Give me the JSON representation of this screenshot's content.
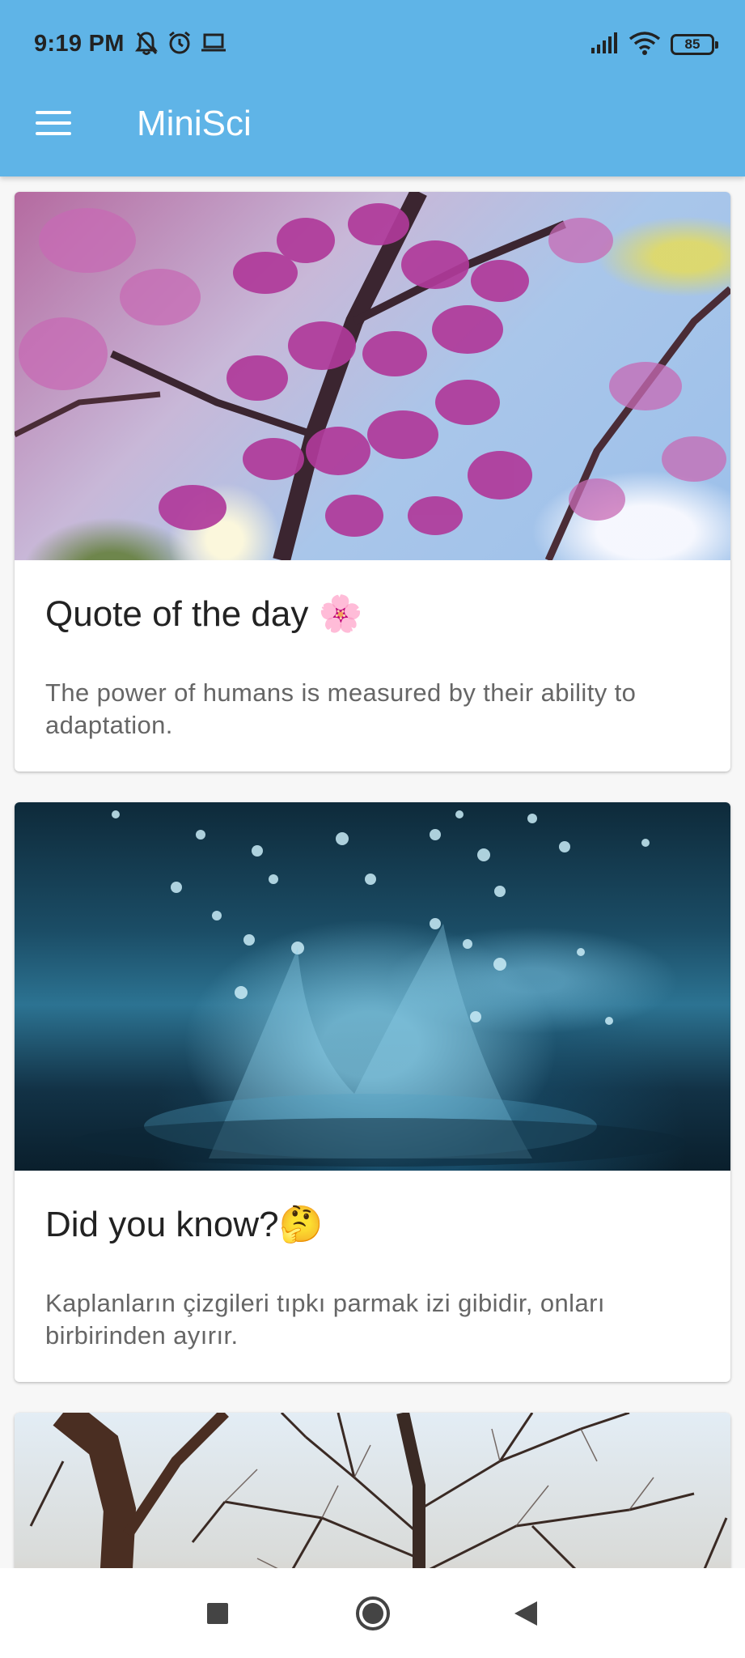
{
  "status_bar": {
    "time": "9:19 PM",
    "battery": "85",
    "icons_left": [
      "muted-bell-icon",
      "alarm-icon",
      "laptop-icon"
    ],
    "icons_right": [
      "signal-icon",
      "wifi-icon",
      "battery-icon"
    ]
  },
  "app_bar": {
    "title": "MiniSci",
    "menu_icon": "hamburger-menu-icon",
    "background": "#5fb4e7"
  },
  "cards": [
    {
      "image": "pink-blossom-photo",
      "title": "Quote of the day 🌸",
      "text": "The power of humans is measured by their ability to adaptation."
    },
    {
      "image": "water-splash-photo",
      "title": "Did you know?🤔",
      "text": "Kaplanların çizgileri tıpkı parmak izi gibidir, onları birbirinden ayırır."
    },
    {
      "image": "bare-tree-photo",
      "title": "",
      "text": ""
    }
  ],
  "nav_bar": {
    "buttons": [
      "recents-square-icon",
      "home-circle-icon",
      "back-triangle-icon"
    ]
  }
}
